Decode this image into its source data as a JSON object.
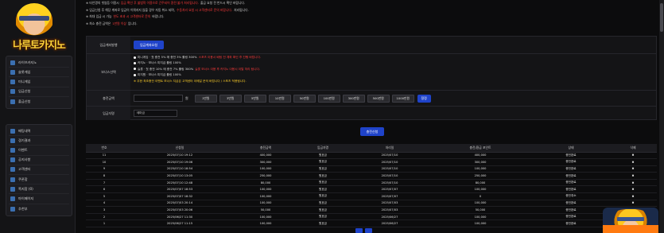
{
  "brand": {
    "logo_text": "나루토카지노"
  },
  "sidebar": {
    "group1": [
      {
        "label": "라이브카지노",
        "icon": "dice-icon"
      },
      {
        "label": "슬롯게임",
        "icon": "slot-icon"
      },
      {
        "label": "미니게임",
        "icon": "gamepad-icon"
      },
      {
        "label": "입금신청",
        "icon": "deposit-icon"
      },
      {
        "label": "출금신청",
        "icon": "withdraw-icon"
      }
    ],
    "group2": [
      {
        "label": "배팅내역",
        "icon": "history-icon"
      },
      {
        "label": "경기결과",
        "icon": "result-icon"
      },
      {
        "label": "이벤트",
        "icon": "event-icon"
      },
      {
        "label": "공지사항",
        "icon": "notice-icon"
      },
      {
        "label": "고객센터",
        "icon": "support-icon"
      },
      {
        "label": "쿠폰함",
        "icon": "coupon-icon"
      },
      {
        "label": "쪽지함 (0)",
        "icon": "mail-icon"
      },
      {
        "label": "마이페이지",
        "icon": "user-icon"
      },
      {
        "label": "추천부",
        "icon": "referral-icon"
      }
    ]
  },
  "notices": [
    {
      "text": "※ 타인명의 빗썸등 이용시 ",
      "red": "입금 확인 후 불법적 이용으로 간주되어 환전 불가 처리됩니다.",
      "tail": " 출금 요청 전 반드시 확인 바랍니다."
    },
    {
      "text": "※ 입금신청 후 해당 계좌로 입금이 이뤄지지 않을 경우 자동 취소 되며, ",
      "red": "수동처리 요청 시 고객센터로 문의 바랍니다.",
      "tail": " 처리됩니다."
    },
    {
      "text": "※ 최대 입금 시 가능 ",
      "red": "한도 초과 시 고객센터로 문의",
      "tail": " 바랍니다."
    },
    {
      "text": "※ 최소 충전 금액은 ",
      "red": "1만원 이상",
      "tail": " 입니다."
    }
  ],
  "form": {
    "account_label": "입금계좌발행",
    "account_button": "입금계좌요청",
    "bonus_label": "보너스선택",
    "bonus_options": [
      {
        "main": "미니게임 · 첫 충전 5% 매 충전 3% 롤링 300%",
        "warn": " 스포츠 이용시 배팅 전 계좌 확인 후 진행 바랍니다.",
        "extra": ""
      },
      {
        "main": "카지노 · 보너스 미지급 롤링 100%",
        "warn": "",
        "extra": ""
      },
      {
        "main": "슬롯 · 첫 충전 10% 매 충전 7% 롤링 300%",
        "warn": " 슬롯 보너스 이용 후 카지노 이용시 이탈 처리 됩니다.",
        "extra": ""
      },
      {
        "main": "미지원 · 보너스 미지급 롤링 100%",
        "warn": "",
        "extra": ""
      },
      {
        "main": "",
        "warn": "",
        "extra": "※ 무한 최초충전 이벤트 보너스 지급은 고객센터 이메일 문의 바랍니다 / 스포츠 적용됩니다."
      }
    ],
    "amount_label": "충전금액",
    "amount_unit": "원",
    "amount_buttons": [
      "1만원",
      "3만원",
      "5만원",
      "10만원",
      "50만원",
      "100만원",
      "300만원",
      "500만원",
      "1000만원"
    ],
    "reset_button": "정정",
    "depositor_label": "입금자명",
    "depositor_value": "테마금",
    "submit_button": "충전신청"
  },
  "table": {
    "headers": [
      "번호",
      "신청일",
      "충전금액",
      "입금자명",
      "처리일",
      "충전/환금 포인트",
      "상태",
      "삭제"
    ],
    "rows": [
      [
        "11",
        "2025/07/10 19:12",
        "400,000",
        "원호금",
        "2025/07/10",
        "400,000",
        "충전완료",
        "✖"
      ],
      [
        "10",
        "2025/07/10 19:06",
        "300,000",
        "원호금",
        "2025/07/10",
        "300,000",
        "충전완료",
        "✖"
      ],
      [
        "9",
        "2025/07/10 18:54",
        "100,000",
        "원호금",
        "2025/07/10",
        "100,000",
        "충전완료",
        "✖"
      ],
      [
        "8",
        "2025/07/10 13:05",
        "250,000",
        "원호금",
        "2025/07/10",
        "250,000",
        "충전완료",
        "✖"
      ],
      [
        "7",
        "2025/07/10 12:48",
        "80,000",
        "원호금",
        "2025/07/10",
        "80,000",
        "충전완료",
        "✖"
      ],
      [
        "6",
        "2025/07/07 18:53",
        "100,000",
        "원호금",
        "2025/07/07",
        "100,000",
        "충전완료",
        "✖"
      ],
      [
        "5",
        "2025/07/07 18:32",
        "100,000",
        "원호금",
        "2025/07/07",
        "0",
        "충전취소",
        "✖"
      ],
      [
        "4",
        "2025/07/03 20:14",
        "100,000",
        "원호금",
        "2025/07/03",
        "100,000",
        "충전완료",
        "✖"
      ],
      [
        "3",
        "2025/07/03 20:06",
        "50,000",
        "원호금",
        "2025/07/03",
        "50,000",
        "충전완료",
        "✖"
      ],
      [
        "2",
        "2025/06/27 11:30",
        "100,000",
        "원호금",
        "2025/06/27",
        "100,000",
        "충전완료",
        "✖"
      ],
      [
        "1",
        "2025/06/27 11:15",
        "100,000",
        "원호금",
        "2025/06/27",
        "100,000",
        "충전완료",
        "✖"
      ]
    ]
  }
}
